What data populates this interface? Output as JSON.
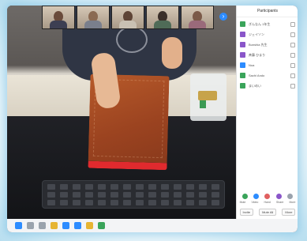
{
  "panel": {
    "title": "Participants",
    "participants": [
      {
        "name": "ぎんなん 1年生",
        "color": "#3aa45a"
      },
      {
        "name": "ジェイソン",
        "color": "#8a56c9"
      },
      {
        "name": "Bunshia 先生",
        "color": "#8a56c9"
      },
      {
        "name": "斉藤 ひまり",
        "color": "#8a56c9"
      },
      {
        "name": "Noa",
        "color": "#2d8cff"
      },
      {
        "name": "Sachi Ando",
        "color": "#3aa45a"
      },
      {
        "name": "まいめい",
        "color": "#3aa45a"
      }
    ],
    "actions": [
      {
        "icon": "mute-icon",
        "label": "Mute",
        "color": "#3aa45a"
      },
      {
        "icon": "video-icon",
        "label": "Video",
        "color": "#2d8cff"
      },
      {
        "icon": "raise-hand-icon",
        "label": "Hand",
        "color": "#e06060"
      },
      {
        "icon": "share-icon",
        "label": "Share",
        "color": "#8a56c9"
      },
      {
        "icon": "more-icon",
        "label": "More",
        "color": "#9aa3ad"
      }
    ],
    "buttons": [
      "Invite",
      "Mute All",
      "More"
    ]
  },
  "gallery": {
    "thumbnails": 5,
    "next_icon": "next-arrow-icon"
  },
  "taskbar": {
    "icons": [
      "start-icon",
      "search-icon",
      "explorer-icon",
      "chrome-icon",
      "mail-icon",
      "zoom-icon",
      "folder-icon",
      "store-icon"
    ]
  }
}
